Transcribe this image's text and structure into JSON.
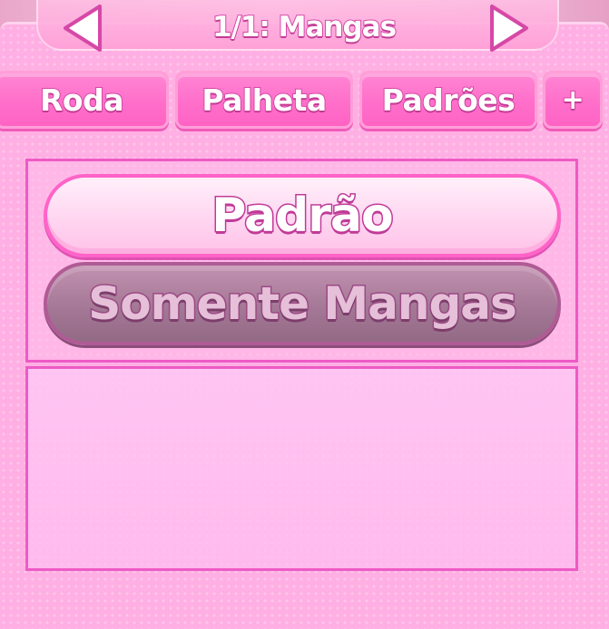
{
  "header": {
    "title": "1/1: Mangas",
    "prev_icon": "arrow-left-icon",
    "next_icon": "arrow-right-icon"
  },
  "tabs": [
    {
      "label": "Roda"
    },
    {
      "label": "Palheta"
    },
    {
      "label": "Padrões"
    },
    {
      "label": "+"
    }
  ],
  "options": {
    "default_label": "Padrão",
    "sleeves_only_label": "Somente Mangas"
  },
  "colors": {
    "panel": "#ffafe3",
    "accent": "#ff63c4",
    "outline": "#d648a6",
    "selected_option": "#ffd8f1",
    "disabled_option": "#a47896"
  }
}
